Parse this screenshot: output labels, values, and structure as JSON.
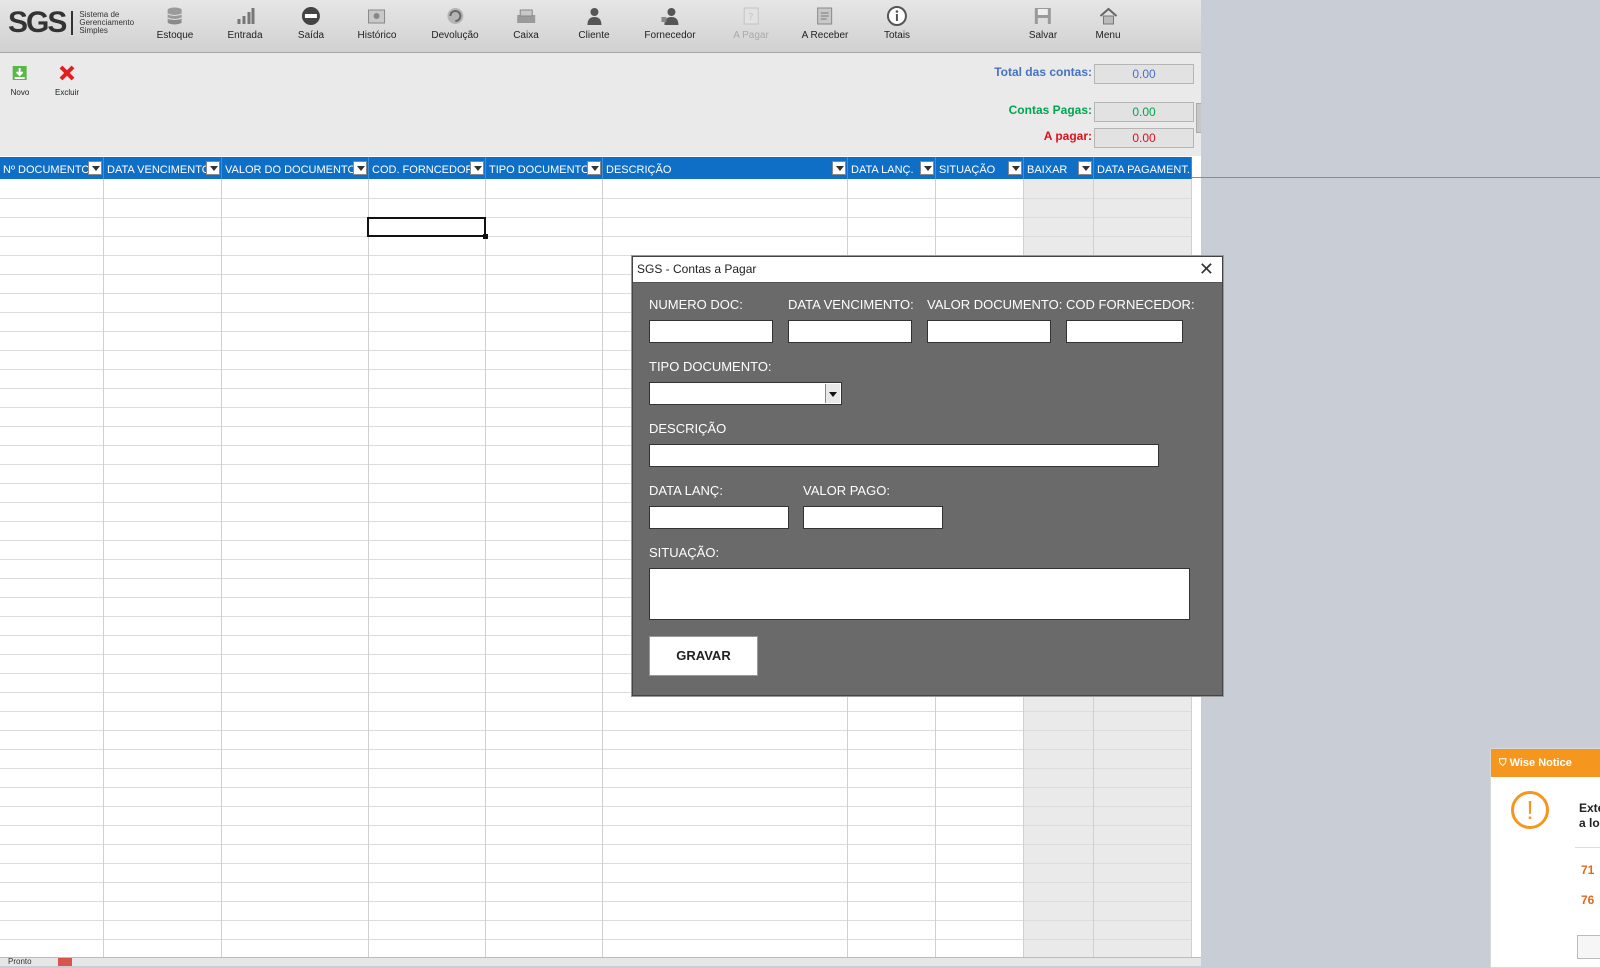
{
  "app": {
    "logo_text": "SGS",
    "logo_subtitle": "Sistema de Gerenciamento Simples"
  },
  "ribbon": {
    "buttons": [
      {
        "label": "Estoque",
        "icon": "database-icon"
      },
      {
        "label": "Entrada",
        "icon": "bar-chart-icon"
      },
      {
        "label": "Saída",
        "icon": "minus-circle-icon"
      },
      {
        "label": "Histórico",
        "icon": "history-icon"
      },
      {
        "label": "Devolução",
        "icon": "return-icon"
      },
      {
        "label": "Caixa",
        "icon": "cash-register-icon"
      },
      {
        "label": "Cliente",
        "icon": "person-icon"
      },
      {
        "label": "Fornecedor",
        "icon": "supplier-icon"
      },
      {
        "label": "A Pagar",
        "icon": "document-question-icon"
      },
      {
        "label": "A Receber",
        "icon": "receive-icon"
      },
      {
        "label": "Totais",
        "icon": "info-icon"
      },
      {
        "label": "Salvar",
        "icon": "save-icon"
      },
      {
        "label": "Menu",
        "icon": "home-icon"
      }
    ]
  },
  "actions": {
    "novo_label": "Novo",
    "excluir_label": "Excluir"
  },
  "summary": {
    "total_label": "Total das contas:",
    "total_value": "0.00",
    "pagas_label": "Contas Pagas:",
    "pagas_value": "0.00",
    "apagar_label": "A pagar:",
    "apagar_value": "0.00",
    "colors": {
      "total": "#4472c4",
      "pagas": "#00a550",
      "apagar": "#e0101a"
    }
  },
  "table": {
    "columns": [
      "Nº DOCUMENTO",
      "DATA VENCIMENTO",
      "VALOR DO DOCUMENTO",
      "COD. FORNCEDOR",
      "TIPO DOCUMENTO",
      "DESCRIÇÃO",
      "DATA LANÇ.",
      "SITUAÇÃO",
      "BAIXAR",
      "DATA PAGAMENT."
    ],
    "header_color": "#0f6fc6"
  },
  "dialog": {
    "title": "SGS - Contas a Pagar",
    "numero_doc_label": "NUMERO DOC:",
    "data_venc_label": "DATA VENCIMENTO:",
    "valor_doc_label": "VALOR DOCUMENTO:",
    "cod_forn_label": "COD FORNECEDOR:",
    "tipo_doc_label": "TIPO DOCUMENTO:",
    "descricao_label": "DESCRIÇÃO",
    "data_lanc_label": "DATA LANÇ:",
    "valor_pago_label": "VALOR PAGO:",
    "situacao_label": "SITUAÇÃO:",
    "gravar_label": "GRAVAR"
  },
  "statusbar": {
    "ready_text": "Pronto"
  },
  "notice": {
    "title": "Wise Notice",
    "text_line1": "Exte",
    "text_line2": "a lo",
    "num1": "71",
    "num2": "76"
  }
}
